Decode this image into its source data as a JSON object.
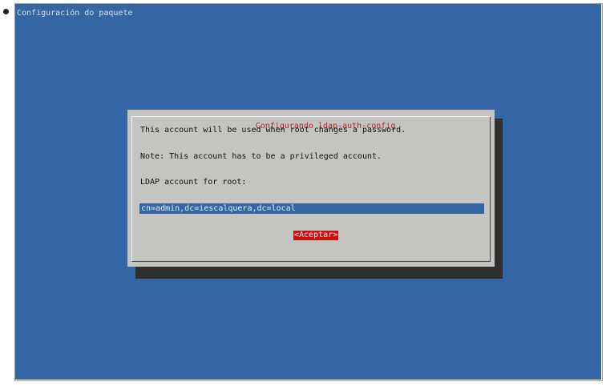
{
  "terminal": {
    "backtitle": "Configuración do paquete"
  },
  "dialog": {
    "title": "Configurando ldap-auth-config",
    "lines": [
      "This account will be used when root changes a password.",
      "Note: This account has to be a privileged account.",
      "LDAP account for root:"
    ],
    "input_value": "cn=admin,dc=iescalquera,dc=local",
    "ok_button_label": "<Aceptar>"
  },
  "colors": {
    "terminal_background": "#3465a4",
    "dialog_background": "#c4c4c0",
    "title_text": "#b52424",
    "input_background": "#3465a4",
    "button_background": "#cc1010",
    "shadow": "#2f2f2f"
  }
}
